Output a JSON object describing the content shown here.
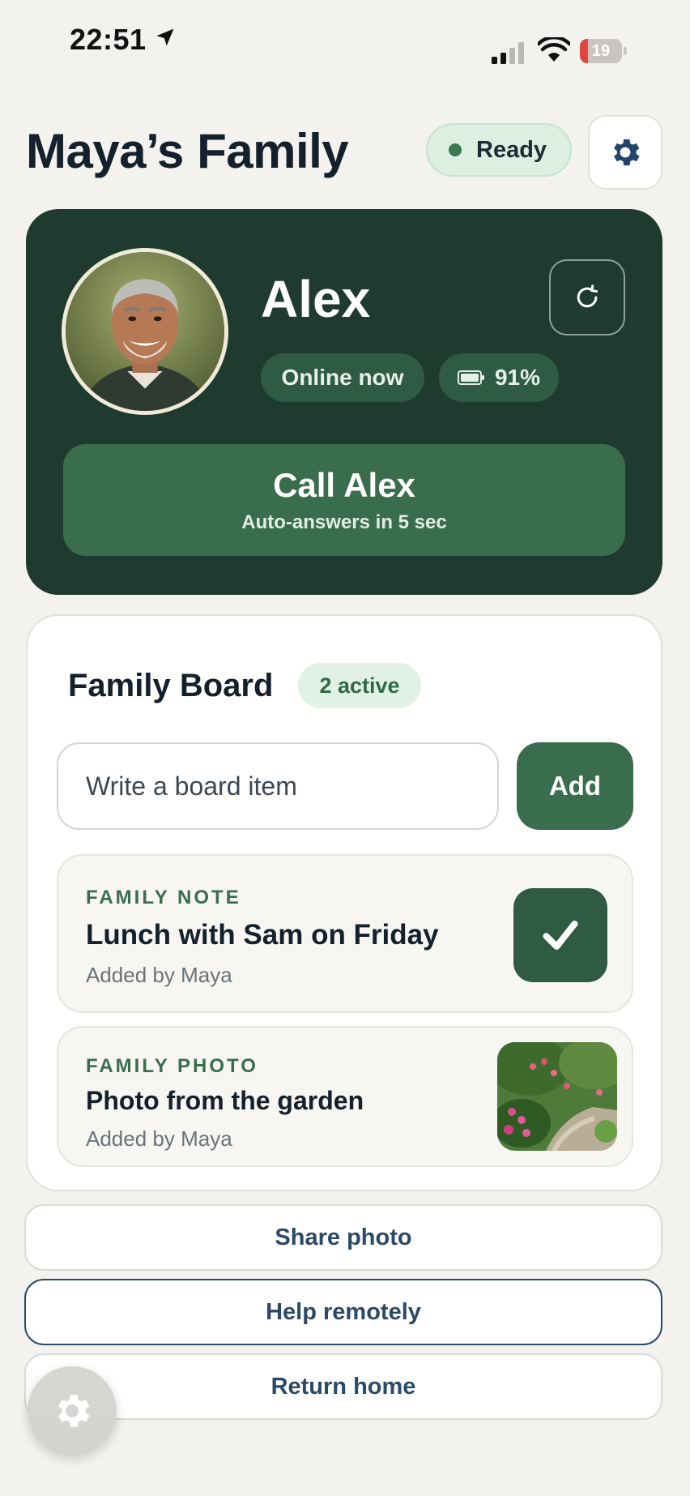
{
  "status_bar": {
    "time": "22:51",
    "battery_level": "19",
    "battery_fraction": 0.19,
    "icons": [
      "location-arrow-icon",
      "cellular-signal-icon",
      "wifi-icon",
      "battery-icon"
    ]
  },
  "header": {
    "title": "Maya’s Family",
    "status_label": "Ready",
    "settings_icon": "gear-icon"
  },
  "contact": {
    "name": "Alex",
    "presence": "Online now",
    "battery": "91%",
    "call_label": "Call Alex",
    "call_sublabel": "Auto-answers in 5 sec",
    "refresh_icon": "refresh-icon"
  },
  "board": {
    "title": "Family Board",
    "active_count": "2 active",
    "input_placeholder": "Write a board item",
    "add_label": "Add",
    "items": [
      {
        "kind": "FAMILY NOTE",
        "text": "Lunch with Sam on Friday",
        "meta": "Added by Maya",
        "action_icon": "checkmark-icon"
      },
      {
        "kind": "FAMILY PHOTO",
        "text": "Photo from the garden",
        "meta": "Added by Maya",
        "thumbnail": "garden-photo"
      }
    ]
  },
  "actions": {
    "share": "Share photo",
    "help": "Help remotely",
    "home": "Return home"
  },
  "floating_button_icon": "gear-icon",
  "colors": {
    "background": "#f3f2ee",
    "dark_card": "#1f3a2e",
    "accent_green": "#3a6d4d",
    "text_dark": "#14202b",
    "link_blue": "#2b4a67"
  }
}
